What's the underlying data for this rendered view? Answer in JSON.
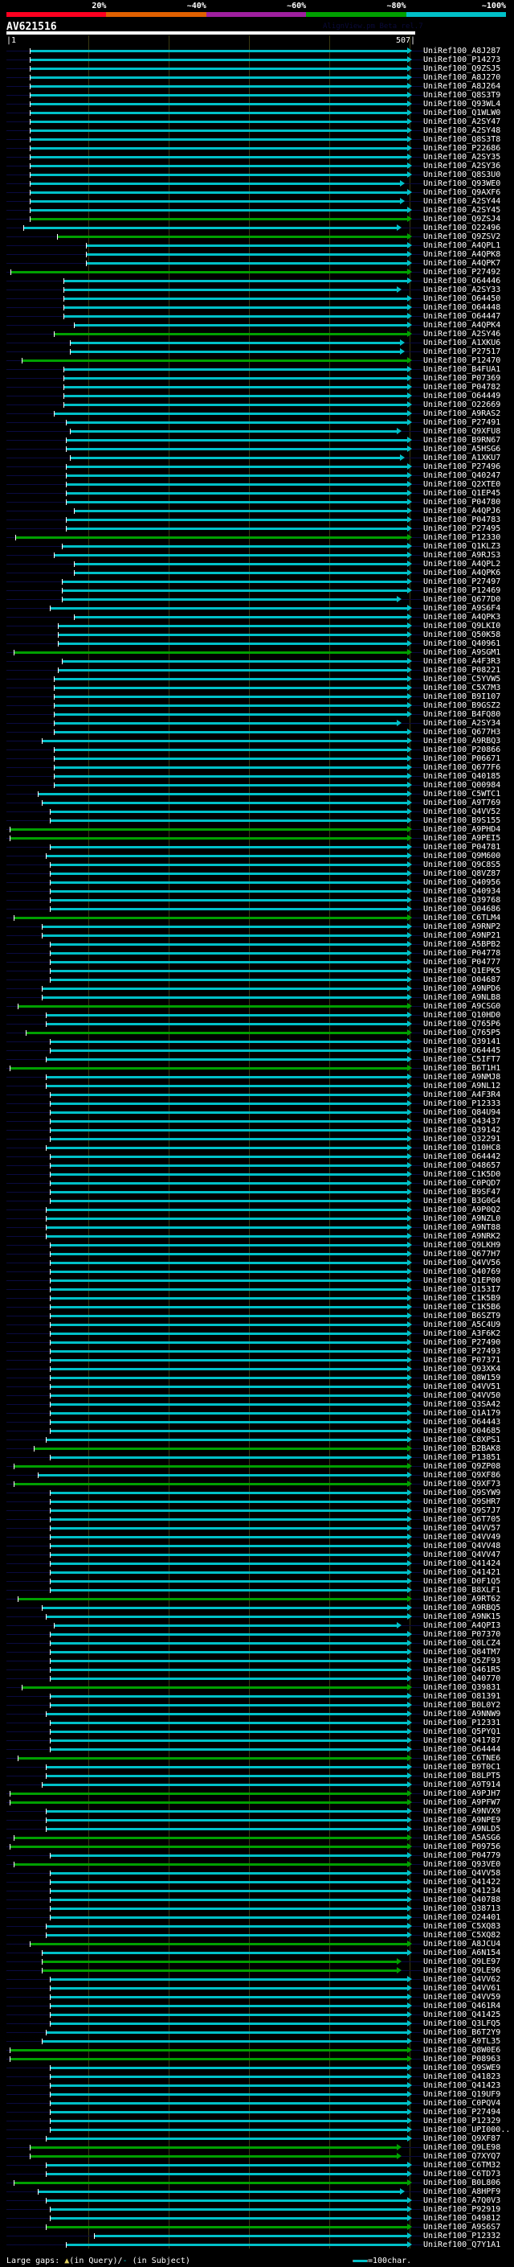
{
  "header": {
    "scale": [
      {
        "label": "20%",
        "color": "#ff0020"
      },
      {
        "label": "~40%",
        "color": "#e06000"
      },
      {
        "label": "~60%",
        "color": "#a020a0"
      },
      {
        "label": "~80%",
        "color": "#00a000"
      },
      {
        "label": "~100%",
        "color": "#00c0c8"
      }
    ],
    "query_name": "AV621516",
    "version": "AlignView.pm Beta rel.7",
    "ruler_start": "|1",
    "ruler_end": "507|"
  },
  "query_length": 507,
  "colors": {
    "cyan": "#00c0c8",
    "green": "#00a000",
    "unaligned": "#0a0a40"
  },
  "rows": [
    [
      "UniRef100_A8J287",
      "c",
      30,
      507
    ],
    [
      "UniRef100_P14273",
      "c",
      30,
      507
    ],
    [
      "UniRef100_Q9ZSJ5",
      "c",
      30,
      507
    ],
    [
      "UniRef100_A8J270",
      "c",
      30,
      507
    ],
    [
      "UniRef100_A8J264",
      "c",
      30,
      507
    ],
    [
      "UniRef100_Q8S3T9",
      "c",
      30,
      507
    ],
    [
      "UniRef100_Q93WL4",
      "c",
      30,
      507
    ],
    [
      "UniRef100_Q1WLW0",
      "c",
      30,
      507
    ],
    [
      "UniRef100_A2SY47",
      "c",
      30,
      507
    ],
    [
      "UniRef100_A2SY48",
      "c",
      30,
      507
    ],
    [
      "UniRef100_Q8S3T8",
      "c",
      30,
      507
    ],
    [
      "UniRef100_P22686",
      "c",
      30,
      507
    ],
    [
      "UniRef100_A2SY35",
      "c",
      30,
      507
    ],
    [
      "UniRef100_A2SY36",
      "c",
      30,
      507
    ],
    [
      "UniRef100_Q8S3U0",
      "c",
      30,
      507
    ],
    [
      "UniRef100_Q93WE0",
      "c",
      30,
      498
    ],
    [
      "UniRef100_Q9AXF6",
      "c",
      30,
      507
    ],
    [
      "UniRef100_A2SY44",
      "c",
      30,
      498
    ],
    [
      "UniRef100_A2SY45",
      "c",
      30,
      507
    ],
    [
      "UniRef100_Q9ZSJ4",
      "g",
      30,
      507
    ],
    [
      "UniRef100_O22496",
      "c",
      22,
      494
    ],
    [
      "UniRef100_Q9ZSV2",
      "g",
      64,
      507
    ],
    [
      "UniRef100_A4QPL1",
      "c",
      100,
      507
    ],
    [
      "UniRef100_A4QPK8",
      "c",
      100,
      507
    ],
    [
      "UniRef100_A4QPK7",
      "c",
      100,
      507
    ],
    [
      "UniRef100_P27492",
      "g",
      6,
      507
    ],
    [
      "UniRef100_O64446",
      "c",
      72,
      507
    ],
    [
      "UniRef100_A2SY33",
      "c",
      72,
      494
    ],
    [
      "UniRef100_O64450",
      "c",
      72,
      507
    ],
    [
      "UniRef100_O64448",
      "c",
      72,
      507
    ],
    [
      "UniRef100_O64447",
      "c",
      72,
      507
    ],
    [
      "UniRef100_A4QPK4",
      "c",
      85,
      507
    ],
    [
      "UniRef100_A2SY46",
      "g",
      60,
      507
    ],
    [
      "UniRef100_A1XKU6",
      "c",
      80,
      498
    ],
    [
      "UniRef100_P27517",
      "c",
      80,
      498
    ],
    [
      "UniRef100_P12470",
      "g",
      20,
      507
    ],
    [
      "UniRef100_B4FUA1",
      "c",
      72,
      507
    ],
    [
      "UniRef100_P07369",
      "c",
      72,
      507
    ],
    [
      "UniRef100_P04782",
      "c",
      72,
      507
    ],
    [
      "UniRef100_O64449",
      "c",
      72,
      507
    ],
    [
      "UniRef100_O22669",
      "c",
      72,
      507
    ],
    [
      "UniRef100_A9RAS2",
      "c",
      60,
      507
    ],
    [
      "UniRef100_P27491",
      "c",
      75,
      507
    ],
    [
      "UniRef100_Q9XFU8",
      "c",
      80,
      494
    ],
    [
      "UniRef100_B9RN67",
      "c",
      75,
      507
    ],
    [
      "UniRef100_A5HSG6",
      "c",
      75,
      507
    ],
    [
      "UniRef100_A1XKU7",
      "c",
      80,
      498
    ],
    [
      "UniRef100_P27496",
      "c",
      75,
      507
    ],
    [
      "UniRef100_Q40247",
      "c",
      75,
      507
    ],
    [
      "UniRef100_Q2XTE0",
      "c",
      75,
      507
    ],
    [
      "UniRef100_Q1EP45",
      "c",
      75,
      507
    ],
    [
      "UniRef100_P04780",
      "c",
      75,
      507
    ],
    [
      "UniRef100_A4QPJ6",
      "c",
      85,
      507
    ],
    [
      "UniRef100_P04783",
      "c",
      75,
      507
    ],
    [
      "UniRef100_P27495",
      "c",
      75,
      507
    ],
    [
      "UniRef100_P12330",
      "g",
      12,
      507
    ],
    [
      "UniRef100_Q1KLZ3",
      "c",
      70,
      507
    ],
    [
      "UniRef100_A9RJS3",
      "c",
      60,
      507
    ],
    [
      "UniRef100_A4QPL2",
      "c",
      85,
      507
    ],
    [
      "UniRef100_A4QPK6",
      "c",
      85,
      507
    ],
    [
      "UniRef100_P27497",
      "c",
      70,
      507
    ],
    [
      "UniRef100_P12469",
      "c",
      70,
      507
    ],
    [
      "UniRef100_Q677D0",
      "c",
      70,
      494
    ],
    [
      "UniRef100_A9S6F4",
      "c",
      55,
      507
    ],
    [
      "UniRef100_A4QPK3",
      "c",
      85,
      507
    ],
    [
      "UniRef100_Q9LKI0",
      "c",
      65,
      507
    ],
    [
      "UniRef100_Q50K58",
      "c",
      65,
      507
    ],
    [
      "UniRef100_Q40961",
      "c",
      65,
      507
    ],
    [
      "UniRef100_A9SGM1",
      "g",
      10,
      507
    ],
    [
      "UniRef100_A4F3R3",
      "c",
      70,
      507
    ],
    [
      "UniRef100_P08221",
      "c",
      65,
      507
    ],
    [
      "UniRef100_C5YVW5",
      "c",
      60,
      507
    ],
    [
      "UniRef100_C5X7M3",
      "c",
      60,
      507
    ],
    [
      "UniRef100_B9I107",
      "c",
      60,
      507
    ],
    [
      "UniRef100_B9GSZ2",
      "c",
      60,
      507
    ],
    [
      "UniRef100_B4FQ80",
      "c",
      60,
      507
    ],
    [
      "UniRef100_A2SY34",
      "c",
      60,
      494
    ],
    [
      "UniRef100_Q677H3",
      "c",
      60,
      507
    ],
    [
      "UniRef100_A9RBQ3",
      "c",
      45,
      507
    ],
    [
      "UniRef100_P20866",
      "c",
      60,
      507
    ],
    [
      "UniRef100_P06671",
      "c",
      60,
      507
    ],
    [
      "UniRef100_Q677F6",
      "c",
      60,
      507
    ],
    [
      "UniRef100_Q40185",
      "c",
      60,
      507
    ],
    [
      "UniRef100_Q00984",
      "c",
      60,
      507
    ],
    [
      "UniRef100_C5WTC1",
      "c",
      40,
      507
    ],
    [
      "UniRef100_A9T769",
      "c",
      45,
      507
    ],
    [
      "UniRef100_Q4VV52",
      "c",
      55,
      507
    ],
    [
      "UniRef100_B9S155",
      "c",
      55,
      507
    ],
    [
      "UniRef100_A9PHD4",
      "g",
      5,
      507
    ],
    [
      "UniRef100_A9PEI5",
      "g",
      5,
      507
    ],
    [
      "UniRef100_P04781",
      "c",
      55,
      507
    ],
    [
      "UniRef100_Q9M600",
      "c",
      50,
      507
    ],
    [
      "UniRef100_Q9C8S5",
      "c",
      55,
      507
    ],
    [
      "UniRef100_Q8VZ87",
      "c",
      55,
      507
    ],
    [
      "UniRef100_Q40956",
      "c",
      55,
      507
    ],
    [
      "UniRef100_Q40934",
      "c",
      55,
      507
    ],
    [
      "UniRef100_Q39768",
      "c",
      55,
      507
    ],
    [
      "UniRef100_O04686",
      "c",
      55,
      507
    ],
    [
      "UniRef100_C6TLM4",
      "g",
      10,
      507
    ],
    [
      "UniRef100_A9RNP2",
      "c",
      45,
      507
    ],
    [
      "UniRef100_A9NP21",
      "c",
      45,
      507
    ],
    [
      "UniRef100_A5BPB2",
      "c",
      55,
      507
    ],
    [
      "UniRef100_P04778",
      "c",
      55,
      507
    ],
    [
      "UniRef100_P04777",
      "c",
      55,
      507
    ],
    [
      "UniRef100_Q1EPK5",
      "c",
      55,
      507
    ],
    [
      "UniRef100_O04687",
      "c",
      55,
      507
    ],
    [
      "UniRef100_A9NPD6",
      "c",
      45,
      507
    ],
    [
      "UniRef100_A9NLB8",
      "c",
      45,
      507
    ],
    [
      "UniRef100_A9CSG0",
      "g",
      15,
      507
    ],
    [
      "UniRef100_Q10HD0",
      "c",
      50,
      507
    ],
    [
      "UniRef100_Q765P6",
      "c",
      50,
      507
    ],
    [
      "UniRef100_Q765P5",
      "g",
      25,
      507
    ],
    [
      "UniRef100_Q39141",
      "c",
      55,
      507
    ],
    [
      "UniRef100_O64445",
      "c",
      55,
      507
    ],
    [
      "UniRef100_C5IFT7",
      "c",
      50,
      507
    ],
    [
      "UniRef100_B6T1H1",
      "g",
      5,
      507
    ],
    [
      "UniRef100_A9NMJ8",
      "c",
      50,
      507
    ],
    [
      "UniRef100_A9NL12",
      "c",
      50,
      507
    ],
    [
      "UniRef100_A4F3R4",
      "c",
      55,
      507
    ],
    [
      "UniRef100_P12333",
      "c",
      55,
      507
    ],
    [
      "UniRef100_Q84U94",
      "c",
      55,
      507
    ],
    [
      "UniRef100_Q43437",
      "c",
      55,
      507
    ],
    [
      "UniRef100_Q39142",
      "c",
      55,
      507
    ],
    [
      "UniRef100_Q32291",
      "c",
      55,
      507
    ],
    [
      "UniRef100_Q10HC8",
      "c",
      50,
      507
    ],
    [
      "UniRef100_O64442",
      "c",
      55,
      507
    ],
    [
      "UniRef100_O48657",
      "c",
      55,
      507
    ],
    [
      "UniRef100_C1K5D0",
      "c",
      55,
      507
    ],
    [
      "UniRef100_C0PQD7",
      "c",
      55,
      507
    ],
    [
      "UniRef100_B9SF47",
      "c",
      55,
      507
    ],
    [
      "UniRef100_B3G0G4",
      "c",
      55,
      507
    ],
    [
      "UniRef100_A9P0Q2",
      "c",
      50,
      507
    ],
    [
      "UniRef100_A9NZL0",
      "c",
      50,
      507
    ],
    [
      "UniRef100_A9NT88",
      "c",
      50,
      507
    ],
    [
      "UniRef100_A9NRK2",
      "c",
      50,
      507
    ],
    [
      "UniRef100_Q9LKH9",
      "c",
      55,
      507
    ],
    [
      "UniRef100_Q677H7",
      "c",
      55,
      507
    ],
    [
      "UniRef100_Q4VV56",
      "c",
      55,
      507
    ],
    [
      "UniRef100_Q40769",
      "c",
      55,
      507
    ],
    [
      "UniRef100_Q1EP00",
      "c",
      55,
      507
    ],
    [
      "UniRef100_Q153I7",
      "c",
      55,
      507
    ],
    [
      "UniRef100_C1K5B9",
      "c",
      55,
      507
    ],
    [
      "UniRef100_C1K5B6",
      "c",
      55,
      507
    ],
    [
      "UniRef100_B6SZT9",
      "c",
      55,
      507
    ],
    [
      "UniRef100_A5C4U9",
      "c",
      55,
      507
    ],
    [
      "UniRef100_A3F6K2",
      "c",
      55,
      507
    ],
    [
      "UniRef100_P27490",
      "c",
      55,
      507
    ],
    [
      "UniRef100_P27493",
      "c",
      55,
      507
    ],
    [
      "UniRef100_P07371",
      "c",
      55,
      507
    ],
    [
      "UniRef100_Q93XK4",
      "c",
      55,
      507
    ],
    [
      "UniRef100_Q8W159",
      "c",
      55,
      507
    ],
    [
      "UniRef100_Q4VV51",
      "c",
      55,
      507
    ],
    [
      "UniRef100_Q4VV50",
      "c",
      55,
      507
    ],
    [
      "UniRef100_Q3SA42",
      "c",
      55,
      507
    ],
    [
      "UniRef100_Q1A179",
      "c",
      55,
      507
    ],
    [
      "UniRef100_O64443",
      "c",
      55,
      507
    ],
    [
      "UniRef100_O04685",
      "c",
      55,
      507
    ],
    [
      "UniRef100_C8XPS1",
      "c",
      50,
      507
    ],
    [
      "UniRef100_B2BAK8",
      "g",
      35,
      507
    ],
    [
      "UniRef100_P13851",
      "c",
      55,
      507
    ],
    [
      "UniRef100_Q9ZP08",
      "g",
      10,
      507
    ],
    [
      "UniRef100_Q9XF86",
      "c",
      40,
      507
    ],
    [
      "UniRef100_Q9XF73",
      "g",
      10,
      507
    ],
    [
      "UniRef100_Q9SYW9",
      "c",
      55,
      507
    ],
    [
      "UniRef100_Q9SHR7",
      "c",
      55,
      507
    ],
    [
      "UniRef100_Q9S7J7",
      "c",
      55,
      507
    ],
    [
      "UniRef100_Q6T705",
      "c",
      55,
      507
    ],
    [
      "UniRef100_Q4VV57",
      "c",
      55,
      507
    ],
    [
      "UniRef100_Q4VV49",
      "c",
      55,
      507
    ],
    [
      "UniRef100_Q4VV48",
      "c",
      55,
      507
    ],
    [
      "UniRef100_Q4VV47",
      "c",
      55,
      507
    ],
    [
      "UniRef100_Q41424",
      "c",
      55,
      507
    ],
    [
      "UniRef100_Q41421",
      "c",
      55,
      507
    ],
    [
      "UniRef100_D0F1Q5",
      "c",
      55,
      507
    ],
    [
      "UniRef100_B8XLF1",
      "c",
      55,
      507
    ],
    [
      "UniRef100_A9RT62",
      "g",
      15,
      507
    ],
    [
      "UniRef100_A9RBQ5",
      "c",
      45,
      507
    ],
    [
      "UniRef100_A9NK15",
      "c",
      50,
      507
    ],
    [
      "UniRef100_A4QPI3",
      "c",
      60,
      494
    ],
    [
      "UniRef100_P07370",
      "c",
      55,
      507
    ],
    [
      "UniRef100_Q8LCZ4",
      "c",
      55,
      507
    ],
    [
      "UniRef100_Q84TM7",
      "c",
      55,
      507
    ],
    [
      "UniRef100_Q5ZF93",
      "c",
      55,
      507
    ],
    [
      "UniRef100_Q461R5",
      "c",
      55,
      507
    ],
    [
      "UniRef100_Q40770",
      "c",
      55,
      507
    ],
    [
      "UniRef100_Q39831",
      "g",
      20,
      507
    ],
    [
      "UniRef100_O81391",
      "c",
      55,
      507
    ],
    [
      "UniRef100_B0L0Y2",
      "c",
      55,
      507
    ],
    [
      "UniRef100_A9NNW9",
      "c",
      50,
      507
    ],
    [
      "UniRef100_P12331",
      "c",
      55,
      507
    ],
    [
      "UniRef100_Q5PYQ1",
      "c",
      55,
      507
    ],
    [
      "UniRef100_Q41787",
      "c",
      55,
      507
    ],
    [
      "UniRef100_O64444",
      "c",
      55,
      507
    ],
    [
      "UniRef100_C6TNE6",
      "g",
      15,
      507
    ],
    [
      "UniRef100_B9T0C1",
      "c",
      50,
      507
    ],
    [
      "UniRef100_B8LPT5",
      "c",
      50,
      507
    ],
    [
      "UniRef100_A9T914",
      "c",
      45,
      507
    ],
    [
      "UniRef100_A9PJH7",
      "g",
      5,
      507
    ],
    [
      "UniRef100_A9PFW7",
      "g",
      5,
      507
    ],
    [
      "UniRef100_A9NVX9",
      "c",
      50,
      507
    ],
    [
      "UniRef100_A9NPE9",
      "c",
      50,
      507
    ],
    [
      "UniRef100_A9NLD5",
      "c",
      50,
      507
    ],
    [
      "UniRef100_A5ASG6",
      "g",
      10,
      507
    ],
    [
      "UniRef100_P09756",
      "g",
      5,
      507
    ],
    [
      "UniRef100_P04779",
      "c",
      55,
      507
    ],
    [
      "UniRef100_Q93VE0",
      "g",
      10,
      507
    ],
    [
      "UniRef100_Q4VV58",
      "c",
      55,
      507
    ],
    [
      "UniRef100_Q41422",
      "c",
      55,
      507
    ],
    [
      "UniRef100_Q41234",
      "c",
      55,
      507
    ],
    [
      "UniRef100_Q40788",
      "c",
      55,
      507
    ],
    [
      "UniRef100_Q38713",
      "c",
      55,
      507
    ],
    [
      "UniRef100_O24401",
      "c",
      55,
      507
    ],
    [
      "UniRef100_C5XQ83",
      "c",
      50,
      507
    ],
    [
      "UniRef100_C5XQ82",
      "c",
      50,
      507
    ],
    [
      "UniRef100_A8JCU4",
      "g",
      30,
      507
    ],
    [
      "UniRef100_A6N154",
      "c",
      45,
      507
    ],
    [
      "UniRef100_Q9LE97",
      "g",
      45,
      494
    ],
    [
      "UniRef100_Q9LE96",
      "g",
      45,
      494
    ],
    [
      "UniRef100_Q4VV62",
      "c",
      55,
      507
    ],
    [
      "UniRef100_Q4VV61",
      "c",
      55,
      507
    ],
    [
      "UniRef100_Q4VV59",
      "c",
      55,
      507
    ],
    [
      "UniRef100_Q461R4",
      "c",
      55,
      507
    ],
    [
      "UniRef100_Q41425",
      "c",
      55,
      507
    ],
    [
      "UniRef100_Q3LFQ5",
      "c",
      55,
      507
    ],
    [
      "UniRef100_B6T2Y9",
      "c",
      50,
      507
    ],
    [
      "UniRef100_A9TL35",
      "c",
      45,
      507
    ],
    [
      "UniRef100_Q8W0E6",
      "g",
      5,
      507
    ],
    [
      "UniRef100_P08963",
      "g",
      5,
      507
    ],
    [
      "UniRef100_Q9SWE9",
      "c",
      55,
      507
    ],
    [
      "UniRef100_Q41823",
      "c",
      55,
      507
    ],
    [
      "UniRef100_Q41423",
      "c",
      55,
      507
    ],
    [
      "UniRef100_Q19UF9",
      "c",
      55,
      507
    ],
    [
      "UniRef100_C0PQV4",
      "c",
      55,
      507
    ],
    [
      "UniRef100_P27494",
      "c",
      55,
      507
    ],
    [
      "UniRef100_P12329",
      "c",
      55,
      507
    ],
    [
      "UniRef100_UPI000..",
      "c",
      55,
      507
    ],
    [
      "UniRef100_Q9XF87",
      "c",
      50,
      507
    ],
    [
      "UniRef100_Q9LE98",
      "g",
      30,
      494
    ],
    [
      "UniRef100_Q7XYQ7",
      "g",
      30,
      494
    ],
    [
      "UniRef100_C6TM32",
      "c",
      50,
      507
    ],
    [
      "UniRef100_C6TD73",
      "c",
      50,
      507
    ],
    [
      "UniRef100_B0L806",
      "g",
      10,
      507
    ],
    [
      "UniRef100_A8HPF9",
      "c",
      40,
      498
    ],
    [
      "UniRef100_A7Q0V3",
      "c",
      50,
      507
    ],
    [
      "UniRef100_P92919",
      "c",
      55,
      507
    ],
    [
      "UniRef100_O49812",
      "c",
      55,
      507
    ],
    [
      "UniRef100_A9S6S7",
      "g",
      50,
      507
    ],
    [
      "UniRef100_P12332",
      "c",
      110,
      507
    ],
    [
      "UniRef100_Q7Y1A1",
      "c",
      75,
      507
    ]
  ],
  "footer": {
    "large_gaps_label": "Large gaps:",
    "in_query": "(in Query)/",
    "in_subject": "(in Subject)",
    "scale_label": "=100char."
  }
}
